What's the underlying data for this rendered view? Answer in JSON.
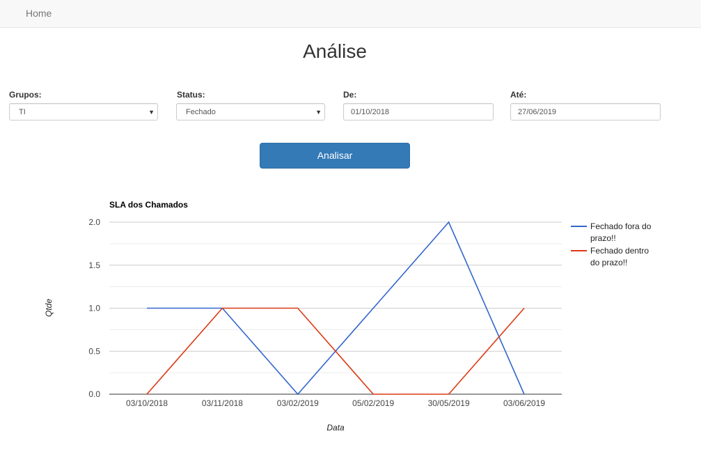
{
  "nav": {
    "home": "Home"
  },
  "page": {
    "title": "Análise"
  },
  "filters": {
    "grupos": {
      "label": "Grupos:",
      "value": "TI"
    },
    "status": {
      "label": "Status:",
      "value": "Fechado"
    },
    "de": {
      "label": "De:",
      "value": "01/10/2018"
    },
    "ate": {
      "label": "Até:",
      "value": "27/06/2019"
    }
  },
  "actions": {
    "analyze": "Analisar"
  },
  "colors": {
    "primary": "#337ab7",
    "series_blue": "#3366cc",
    "series_red": "#dc3912"
  },
  "chart_data": {
    "type": "line",
    "title": "SLA dos Chamados",
    "xlabel": "Data",
    "ylabel": "Qtde",
    "categories": [
      "03/10/2018",
      "03/11/2018",
      "03/02/2019",
      "05/02/2019",
      "30/05/2019",
      "03/06/2019"
    ],
    "yticks": [
      "0.0",
      "0.5",
      "1.0",
      "1.5",
      "2.0"
    ],
    "ylim": [
      0,
      2
    ],
    "grid": true,
    "legend": "right",
    "series": [
      {
        "name": "Fechado fora do prazo!!",
        "name_lines": [
          "Fechado fora do",
          "prazo!!"
        ],
        "color": "#3366cc",
        "values": [
          1,
          1,
          0,
          1,
          2,
          0
        ]
      },
      {
        "name": "Fechado dentro do prazo!!",
        "name_lines": [
          "Fechado dentro",
          "do prazo!!"
        ],
        "color": "#dc3912",
        "values": [
          0,
          1,
          1,
          0,
          0,
          1
        ]
      }
    ]
  }
}
